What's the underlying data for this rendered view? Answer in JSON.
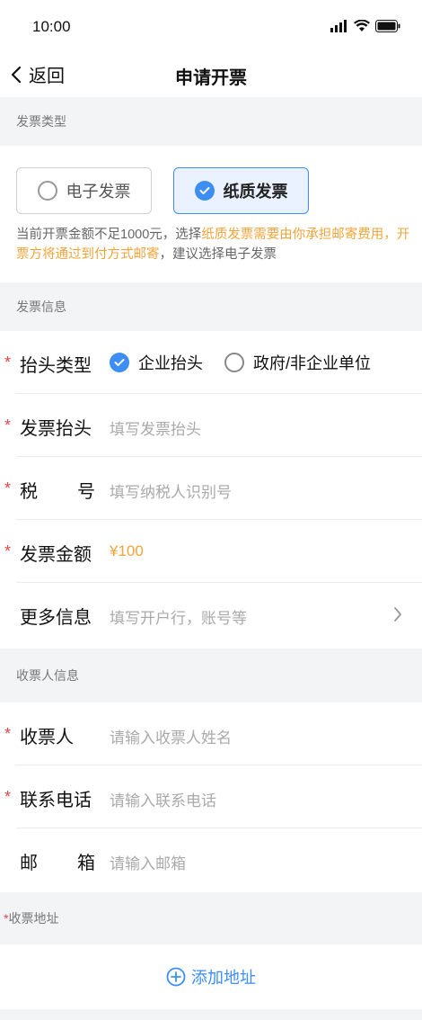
{
  "status": {
    "time": "10:00"
  },
  "nav": {
    "back_label": "返回",
    "title": "申请开票"
  },
  "invoice_type": {
    "header": "发票类型",
    "options": [
      {
        "label": "电子发票",
        "selected": false
      },
      {
        "label": "纸质发票",
        "selected": true
      }
    ],
    "notice_prefix": "当前开票金额不足1000元，选择",
    "notice_highlight": "纸质发票需要由你承担邮寄费用，开票方将通过到付方式邮寄",
    "notice_suffix": "，建议选择电子发票"
  },
  "invoice_info": {
    "header": "发票信息",
    "title_type": {
      "label": "抬头类型",
      "options": [
        {
          "label": "企业抬头",
          "selected": true
        },
        {
          "label": "政府/非企业单位",
          "selected": false
        }
      ]
    },
    "title": {
      "label": "发票抬头",
      "placeholder": "填写发票抬头"
    },
    "tax_no": {
      "label_a": "税",
      "label_b": "号",
      "placeholder": "填写纳税人识别号"
    },
    "amount": {
      "label": "发票金额",
      "value": "¥100"
    },
    "more": {
      "label": "更多信息",
      "placeholder": "填写开户行，账号等"
    }
  },
  "receiver": {
    "header": "收票人信息",
    "name": {
      "label": "收票人",
      "placeholder": "请输入收票人姓名"
    },
    "phone": {
      "label": "联系电话",
      "placeholder": "请输入联系电话"
    },
    "email": {
      "label_a": "邮",
      "label_b": "箱",
      "placeholder": "请输入邮箱"
    },
    "address_header": "收票地址",
    "add_address": "添加地址"
  },
  "colors": {
    "accent": "#3c8ef2",
    "required": "#e04545",
    "highlight": "#f2a43a"
  }
}
